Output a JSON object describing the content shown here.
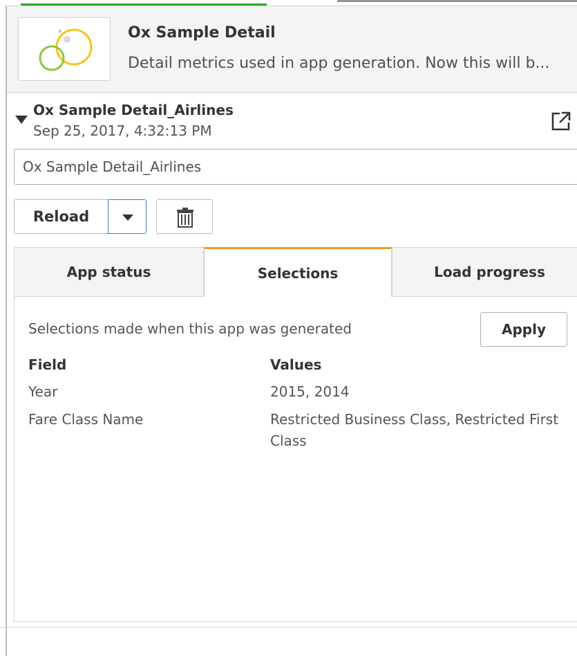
{
  "app": {
    "title": "Ox Sample Detail",
    "description": "Detail metrics used in app generation. Now this will b..."
  },
  "generated_app": {
    "name": "Ox Sample Detail_Airlines",
    "timestamp": "Sep 25, 2017, 4:32:13 PM",
    "name_input_value": "Ox Sample Detail_Airlines"
  },
  "actions": {
    "reload_label": "Reload"
  },
  "tabs": [
    {
      "label": "App status",
      "active": false
    },
    {
      "label": "Selections",
      "active": true
    },
    {
      "label": "Load progress",
      "active": false
    }
  ],
  "selections": {
    "caption": "Selections made when this app was generated",
    "apply_label": "Apply",
    "columns": {
      "field": "Field",
      "values": "Values"
    },
    "rows": [
      {
        "field": "Year",
        "values": "2015, 2014"
      },
      {
        "field": "Fare Class Name",
        "values": "Restricted Business Class, Restricted First Class"
      }
    ]
  },
  "colors": {
    "active_tab_accent": "#f29c1f",
    "dropdown_focus": "#3b7fc4",
    "logo_green": "#8cc63f",
    "logo_yellow": "#f5c518"
  },
  "icons": {
    "logo": "circles-logo-icon",
    "collapse": "caret-down-icon",
    "open": "external-link-icon",
    "dropdown": "chevron-down-icon",
    "delete": "trash-icon"
  }
}
